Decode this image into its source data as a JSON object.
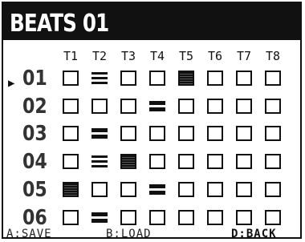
{
  "title": "BEATS 01",
  "columns": [
    "T1",
    "T2",
    "T3",
    "T4",
    "T5",
    "T6",
    "T7",
    "T8"
  ],
  "cursor": "▶",
  "rows": [
    {
      "label": "01",
      "cells": [
        "empty",
        "lines",
        "empty",
        "empty",
        "filled",
        "empty",
        "empty",
        "empty"
      ]
    },
    {
      "label": "02",
      "cells": [
        "empty",
        "empty",
        "empty",
        "bold",
        "empty",
        "empty",
        "empty",
        "empty"
      ]
    },
    {
      "label": "03",
      "cells": [
        "empty",
        "bold",
        "empty",
        "empty",
        "empty",
        "empty",
        "empty",
        "empty"
      ]
    },
    {
      "label": "04",
      "cells": [
        "empty",
        "lines",
        "filled",
        "empty",
        "empty",
        "empty",
        "empty",
        "empty"
      ]
    },
    {
      "label": "05",
      "cells": [
        "filled",
        "empty",
        "empty",
        "bold",
        "empty",
        "empty",
        "empty",
        "empty"
      ]
    },
    {
      "label": "06",
      "cells": [
        "empty",
        "bold",
        "empty",
        "empty",
        "empty",
        "empty",
        "empty",
        "empty"
      ]
    }
  ],
  "footer": {
    "save": "A:SAVE",
    "load": "B:LOAD",
    "back": "D:BACK"
  }
}
